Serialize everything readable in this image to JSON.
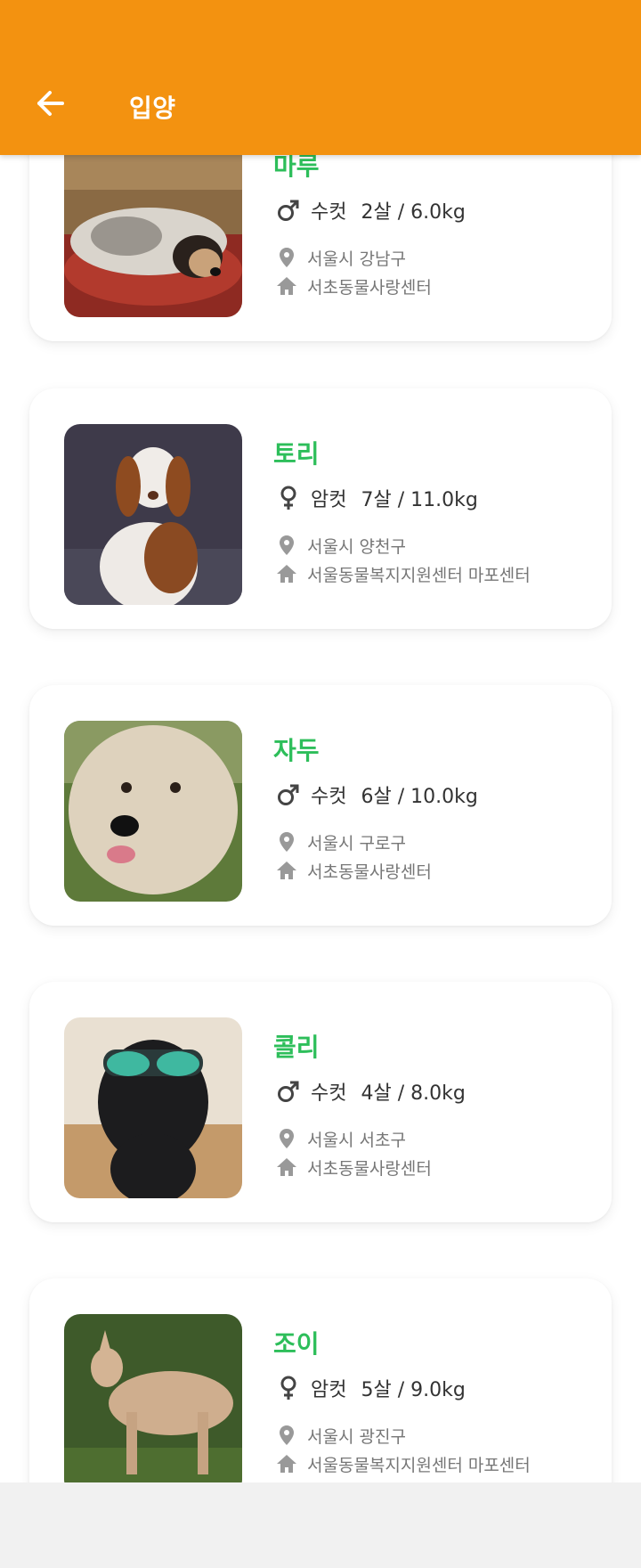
{
  "header": {
    "title": "입양",
    "back_icon": "arrow-left-icon"
  },
  "colors": {
    "accent": "#f39210",
    "name": "#2dbe5a",
    "text": "#333333",
    "muted": "#777777"
  },
  "pets": [
    {
      "name": "마루",
      "sex": "수컷",
      "sex_icon": "male-icon",
      "age_weight": "2살 / 6.0kg",
      "location": "서울시 강남구",
      "shelter": "서초동물사랑센터"
    },
    {
      "name": "토리",
      "sex": "암컷",
      "sex_icon": "female-icon",
      "age_weight": "7살 / 11.0kg",
      "location": "서울시 양천구",
      "shelter": "서울동물복지지원센터 마포센터"
    },
    {
      "name": "자두",
      "sex": "수컷",
      "sex_icon": "male-icon",
      "age_weight": "6살 / 10.0kg",
      "location": "서울시 구로구",
      "shelter": "서초동물사랑센터"
    },
    {
      "name": "콜리",
      "sex": "수컷",
      "sex_icon": "male-icon",
      "age_weight": "4살 / 8.0kg",
      "location": "서울시 서초구",
      "shelter": "서초동물사랑센터"
    },
    {
      "name": "조이",
      "sex": "암컷",
      "sex_icon": "female-icon",
      "age_weight": "5살 / 9.0kg",
      "location": "서울시 광진구",
      "shelter": "서울동물복지지원센터 마포센터"
    }
  ]
}
